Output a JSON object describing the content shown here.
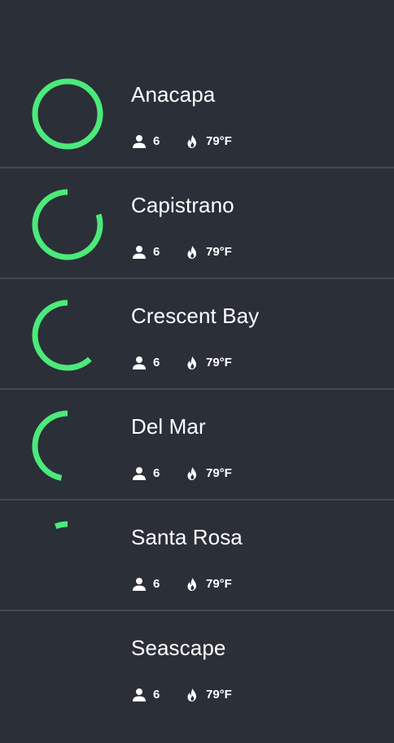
{
  "colors": {
    "background": "#2b2f38",
    "divider": "#434852",
    "ring": "#4bea7a",
    "text": "#ffffff"
  },
  "rooms": [
    {
      "name": "Anacapa",
      "people": "6",
      "temperature": "79°F",
      "availability": 1.0
    },
    {
      "name": "Capistrano",
      "people": "6",
      "temperature": "79°F",
      "availability": 0.8
    },
    {
      "name": "Crescent Bay",
      "people": "6",
      "temperature": "79°F",
      "availability": 0.62
    },
    {
      "name": "Del Mar",
      "people": "6",
      "temperature": "79°F",
      "availability": 0.47
    },
    {
      "name": "Santa Rosa",
      "people": "6",
      "temperature": "79°F",
      "availability": 0.06
    },
    {
      "name": "Seascape",
      "people": "6",
      "temperature": "79°F",
      "availability": 0.0
    }
  ],
  "icons": {
    "people": "person-icon",
    "temperature": "flame-icon"
  }
}
